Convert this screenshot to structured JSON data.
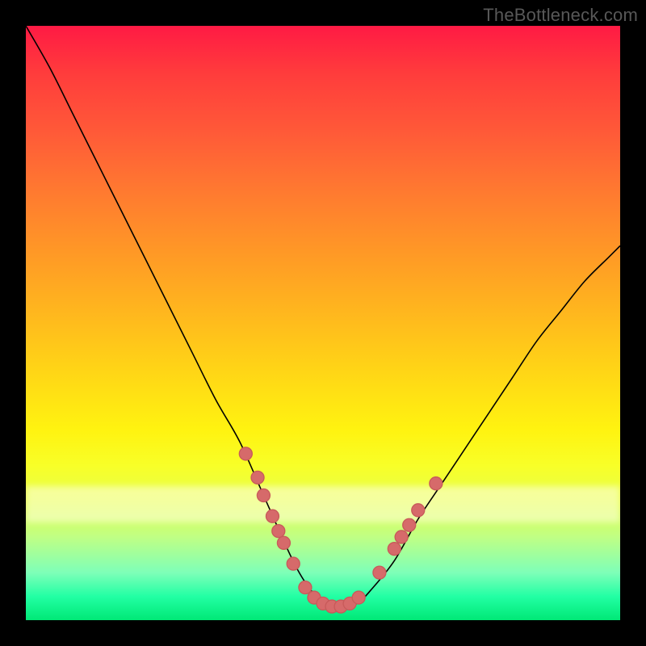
{
  "attribution": "TheBottleneck.com",
  "colors": {
    "frame": "#000000",
    "curve": "#000000",
    "marker_fill": "#d66a6a",
    "marker_stroke": "#c85a5a"
  },
  "chart_data": {
    "type": "line",
    "title": "",
    "xlabel": "",
    "ylabel": "",
    "xlim": [
      0,
      100
    ],
    "ylim": [
      0,
      100
    ],
    "curve": {
      "x": [
        0,
        4,
        8,
        12,
        16,
        20,
        24,
        28,
        32,
        36,
        40,
        44,
        46,
        48,
        50,
        52,
        54,
        56,
        58,
        62,
        66,
        70,
        74,
        78,
        82,
        86,
        90,
        94,
        98,
        100
      ],
      "y": [
        100,
        93,
        85,
        77,
        69,
        61,
        53,
        45,
        37,
        30,
        21,
        12,
        8,
        5,
        3,
        2,
        2,
        3,
        5,
        10,
        17,
        23,
        29,
        35,
        41,
        47,
        52,
        57,
        61,
        63
      ]
    },
    "markers": [
      {
        "x": 37,
        "y": 28
      },
      {
        "x": 39,
        "y": 24
      },
      {
        "x": 40,
        "y": 21
      },
      {
        "x": 41.5,
        "y": 17.5
      },
      {
        "x": 42.5,
        "y": 15
      },
      {
        "x": 43.4,
        "y": 13
      },
      {
        "x": 45,
        "y": 9.5
      },
      {
        "x": 47,
        "y": 5.5
      },
      {
        "x": 48.5,
        "y": 3.8
      },
      {
        "x": 50,
        "y": 2.8
      },
      {
        "x": 51.5,
        "y": 2.3
      },
      {
        "x": 53,
        "y": 2.3
      },
      {
        "x": 54.5,
        "y": 2.8
      },
      {
        "x": 56,
        "y": 3.8
      },
      {
        "x": 59.5,
        "y": 8
      },
      {
        "x": 62,
        "y": 12
      },
      {
        "x": 63.2,
        "y": 14
      },
      {
        "x": 64.5,
        "y": 16
      },
      {
        "x": 66,
        "y": 18.5
      },
      {
        "x": 69,
        "y": 23
      }
    ],
    "marker_radius": 8
  }
}
